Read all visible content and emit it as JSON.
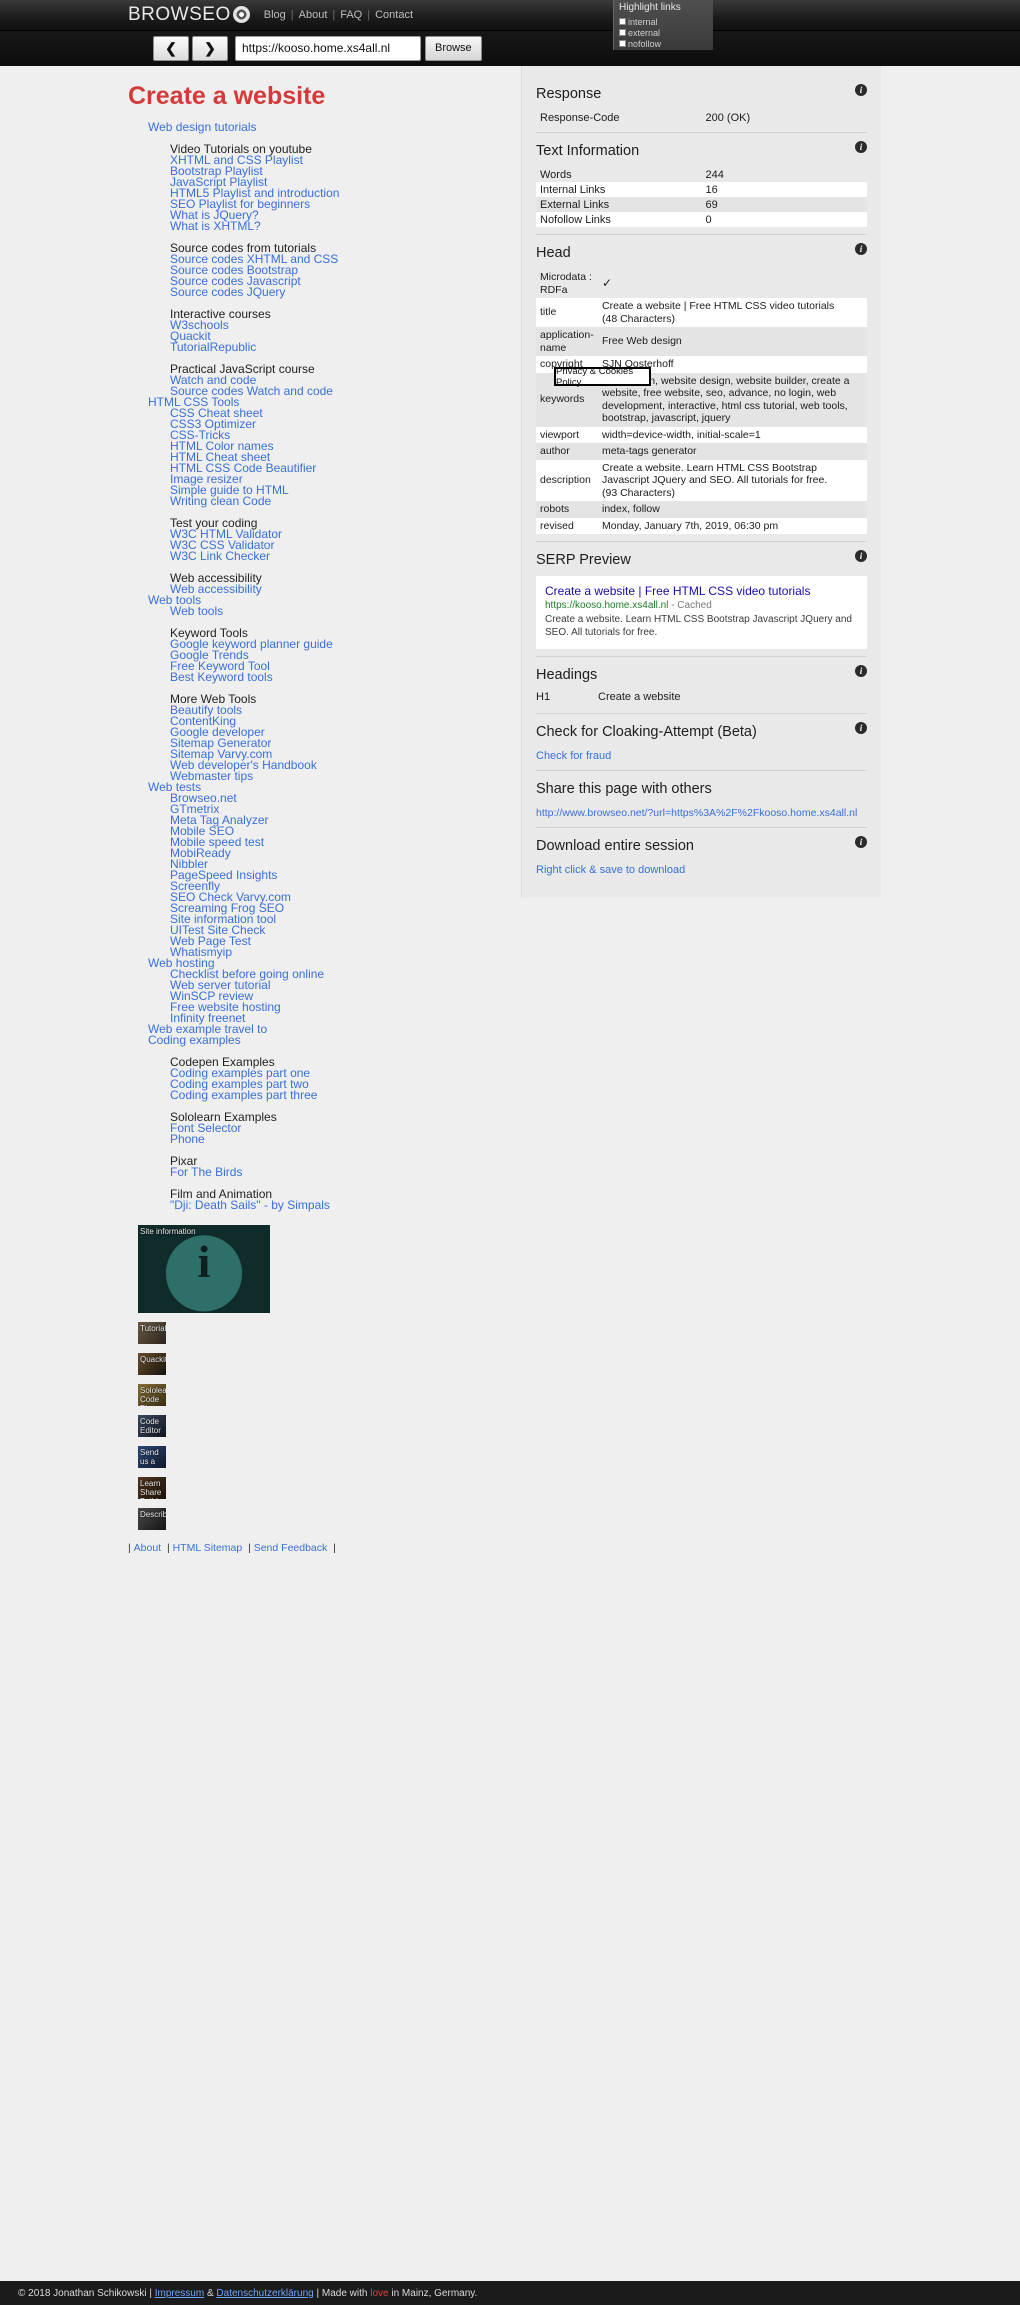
{
  "browser": {
    "brand": "BROWSEO",
    "nav": [
      "Blog",
      "About",
      "FAQ",
      "Contact"
    ],
    "back_icon": "❮",
    "forward_icon": "❯",
    "url_value": "https://kooso.home.xs4all.nl",
    "browse_label": "Browse",
    "highlight": {
      "title": "Highlight links",
      "options": [
        "internal",
        "external",
        "nofollow"
      ]
    }
  },
  "page": {
    "title": "Create a website",
    "tree": [
      {
        "level": 1,
        "label": "",
        "link": false
      },
      {
        "level": 1,
        "label": "Web design tutorials",
        "link": true
      },
      {
        "level": 2,
        "label": "",
        "link": false
      },
      {
        "level": 2,
        "label": "Video Tutorials on youtube",
        "link": false
      },
      {
        "level": 2,
        "label": "XHTML and CSS Playlist",
        "link": true
      },
      {
        "level": 2,
        "label": "Bootstrap Playlist",
        "link": true
      },
      {
        "level": 2,
        "label": "JavaScript Playlist",
        "link": true
      },
      {
        "level": 2,
        "label": "HTML5 Playlist and introduction",
        "link": true
      },
      {
        "level": 2,
        "label": "SEO Playlist for beginners",
        "link": true
      },
      {
        "level": 2,
        "label": "What is JQuery?",
        "link": true
      },
      {
        "level": 2,
        "label": "What is XHTML?",
        "link": true
      },
      {
        "level": 2,
        "label": "",
        "link": false
      },
      {
        "level": 2,
        "label": "Source codes from tutorials",
        "link": false
      },
      {
        "level": 2,
        "label": "Source codes XHTML and CSS",
        "link": true
      },
      {
        "level": 2,
        "label": "Source codes Bootstrap",
        "link": true
      },
      {
        "level": 2,
        "label": "Source codes Javascript",
        "link": true
      },
      {
        "level": 2,
        "label": "Source codes JQuery",
        "link": true
      },
      {
        "level": 2,
        "label": "",
        "link": false
      },
      {
        "level": 2,
        "label": "Interactive courses",
        "link": false
      },
      {
        "level": 2,
        "label": "W3schools",
        "link": true
      },
      {
        "level": 2,
        "label": "Quackit",
        "link": true
      },
      {
        "level": 2,
        "label": "TutorialRepublic",
        "link": true
      },
      {
        "level": 2,
        "label": "",
        "link": false
      },
      {
        "level": 2,
        "label": "Practical JavaScript course",
        "link": false
      },
      {
        "level": 2,
        "label": "Watch and code",
        "link": true
      },
      {
        "level": 2,
        "label": "Source codes Watch and code",
        "link": true
      },
      {
        "level": 1,
        "label": "HTML CSS Tools",
        "link": true
      },
      {
        "level": 2,
        "label": "CSS Cheat sheet",
        "link": true
      },
      {
        "level": 2,
        "label": "CSS3 Optimizer",
        "link": true
      },
      {
        "level": 2,
        "label": "CSS-Tricks",
        "link": true
      },
      {
        "level": 2,
        "label": "HTML Color names",
        "link": true
      },
      {
        "level": 2,
        "label": "HTML Cheat sheet",
        "link": true
      },
      {
        "level": 2,
        "label": "HTML CSS Code Beautifier",
        "link": true
      },
      {
        "level": 2,
        "label": "Image resizer",
        "link": true
      },
      {
        "level": 2,
        "label": "Simple guide to HTML",
        "link": true
      },
      {
        "level": 2,
        "label": "Writing clean Code",
        "link": true
      },
      {
        "level": 2,
        "label": "",
        "link": false
      },
      {
        "level": 2,
        "label": "Test your coding",
        "link": false
      },
      {
        "level": 2,
        "label": "W3C HTML Validator",
        "link": true
      },
      {
        "level": 2,
        "label": "W3C CSS Validator",
        "link": true
      },
      {
        "level": 2,
        "label": "W3C Link Checker",
        "link": true
      },
      {
        "level": 2,
        "label": "",
        "link": false
      },
      {
        "level": 2,
        "label": "Web accessibility",
        "link": false
      },
      {
        "level": 2,
        "label": "Web accessibility",
        "link": true
      },
      {
        "level": 1,
        "label": "Web tools",
        "link": true
      },
      {
        "level": 2,
        "label": "Web tools",
        "link": true
      },
      {
        "level": 2,
        "label": "",
        "link": false
      },
      {
        "level": 2,
        "label": "Keyword Tools",
        "link": false
      },
      {
        "level": 2,
        "label": "Google keyword planner guide",
        "link": true
      },
      {
        "level": 2,
        "label": "Google Trends",
        "link": true
      },
      {
        "level": 2,
        "label": "Free Keyword Tool",
        "link": true
      },
      {
        "level": 2,
        "label": "Best Keyword tools",
        "link": true
      },
      {
        "level": 2,
        "label": "",
        "link": false
      },
      {
        "level": 2,
        "label": "More Web Tools",
        "link": false
      },
      {
        "level": 2,
        "label": "Beautify tools",
        "link": true
      },
      {
        "level": 2,
        "label": "ContentKing",
        "link": true
      },
      {
        "level": 2,
        "label": "Google developer",
        "link": true
      },
      {
        "level": 2,
        "label": "Sitemap Generator",
        "link": true
      },
      {
        "level": 2,
        "label": "Sitemap Varvy.com",
        "link": true
      },
      {
        "level": 2,
        "label": "Web developer's Handbook",
        "link": true
      },
      {
        "level": 2,
        "label": "Webmaster tips",
        "link": true
      },
      {
        "level": 1,
        "label": "Web tests",
        "link": true
      },
      {
        "level": 2,
        "label": "Browseo.net",
        "link": true
      },
      {
        "level": 2,
        "label": "GTmetrix",
        "link": true
      },
      {
        "level": 2,
        "label": "Meta Tag Analyzer",
        "link": true
      },
      {
        "level": 2,
        "label": "Mobile SEO",
        "link": true
      },
      {
        "level": 2,
        "label": "Mobile speed test",
        "link": true
      },
      {
        "level": 2,
        "label": "MobiReady",
        "link": true
      },
      {
        "level": 2,
        "label": "Nibbler",
        "link": true
      },
      {
        "level": 2,
        "label": "PageSpeed Insights",
        "link": true
      },
      {
        "level": 2,
        "label": "Screenfly",
        "link": true
      },
      {
        "level": 2,
        "label": "SEO Check Varvy.com",
        "link": true
      },
      {
        "level": 2,
        "label": "Screaming Frog SEO",
        "link": true
      },
      {
        "level": 2,
        "label": "Site information tool",
        "link": true
      },
      {
        "level": 2,
        "label": "UITest Site Check",
        "link": true
      },
      {
        "level": 2,
        "label": "Web Page Test",
        "link": true
      },
      {
        "level": 2,
        "label": "Whatismyip",
        "link": true
      },
      {
        "level": 1,
        "label": "Web hosting",
        "link": true
      },
      {
        "level": 2,
        "label": "Checklist before going online",
        "link": true
      },
      {
        "level": 2,
        "label": "Web server tutorial",
        "link": true
      },
      {
        "level": 2,
        "label": "WinSCP review",
        "link": true
      },
      {
        "level": 2,
        "label": "Free website hosting",
        "link": true
      },
      {
        "level": 2,
        "label": "Infinity freenet",
        "link": true
      },
      {
        "level": 1,
        "label": "Web example travel to",
        "link": true
      },
      {
        "level": 1,
        "label": "Coding examples",
        "link": true
      },
      {
        "level": 2,
        "label": "",
        "link": false
      },
      {
        "level": 2,
        "label": "Codepen Examples",
        "link": false
      },
      {
        "level": 2,
        "label": "Coding examples part one",
        "link": true
      },
      {
        "level": 2,
        "label": "Coding examples part two",
        "link": true
      },
      {
        "level": 2,
        "label": "Coding examples part three",
        "link": true
      },
      {
        "level": 2,
        "label": "",
        "link": false
      },
      {
        "level": 2,
        "label": "Sololearn Examples",
        "link": false
      },
      {
        "level": 2,
        "label": "Font Selector",
        "link": true
      },
      {
        "level": 2,
        "label": "Phone",
        "link": true
      },
      {
        "level": 2,
        "label": "",
        "link": false
      },
      {
        "level": 2,
        "label": "Pixar",
        "link": false
      },
      {
        "level": 2,
        "label": "For The Birds",
        "link": true
      },
      {
        "level": 2,
        "label": "",
        "link": false
      },
      {
        "level": 2,
        "label": "Film and Animation",
        "link": false
      },
      {
        "level": 2,
        "label": "\"Dji: Death Sails\" - by Simpals",
        "link": true
      }
    ],
    "thumbnails": [
      {
        "name": "site-information",
        "caption": "Site information",
        "glyph": "i",
        "size": "big"
      },
      {
        "name": "tutorials",
        "caption": "Tutorials",
        "size": "small",
        "tone": "a"
      },
      {
        "name": "quackit",
        "caption": "Quackit",
        "size": "small",
        "tone": "b"
      },
      {
        "name": "sololearn-code-playground",
        "caption": "Sololearn Code Playground",
        "size": "small",
        "tone": "c"
      },
      {
        "name": "code-editor",
        "caption": "Code Editor",
        "size": "small",
        "tone": "d"
      },
      {
        "name": "send-us-a",
        "caption": "Send us a",
        "size": "small",
        "tone": "e"
      },
      {
        "name": "learn-share-build",
        "caption": "Learn Share Build",
        "size": "small",
        "tone": "f"
      },
      {
        "name": "describe",
        "caption": "Describe",
        "size": "small",
        "tone": "g"
      }
    ],
    "footer_links": [
      "About",
      "HTML Sitemap",
      "Send Feedback"
    ],
    "footer_bar": {
      "copyright": "© 2018 Jonathan Schikowski",
      "sep": "|",
      "impressum": "Impressum",
      "amp": "&",
      "datenschutz": "Datenschutzerklärung",
      "made_prefix": "| Made with",
      "heart": "love",
      "made_suffix": "in Mainz, Germany."
    }
  },
  "seo": {
    "response": {
      "heading": "Response",
      "rows": [
        [
          "Response-Code",
          "200 (OK)"
        ]
      ]
    },
    "text_information": {
      "heading": "Text Information",
      "rows": [
        [
          "Words",
          "244"
        ],
        [
          "Internal Links",
          "16"
        ],
        [
          "External Links",
          "69"
        ],
        [
          "Nofollow Links",
          "0"
        ]
      ]
    },
    "head": {
      "heading": "Head",
      "microdata_label": "Microdata : RDFa",
      "microdata_value": "✓",
      "rows": [
        [
          "title",
          "Create a website | Free HTML CSS video tutorials\n(48 Characters)"
        ],
        [
          "application-name",
          "Free Web design"
        ],
        [
          "copyright",
          "SJN Oosterhoff"
        ],
        [
          "keywords",
          "web design, website design, website builder, create a website, free website, seo, advance, no login, web development, interactive, html css tutorial, web tools, bootstrap, javascript, jquery"
        ],
        [
          "viewport",
          "width=device-width, initial-scale=1"
        ],
        [
          "author",
          "meta-tags generator"
        ],
        [
          "description",
          "Create a website. Learn HTML CSS Bootstrap Javascript JQuery and SEO. All tutorials for free.\n(93 Characters)"
        ],
        [
          "robots",
          "index, follow"
        ],
        [
          "revised",
          "Monday, January 7th, 2019, 06:30 pm"
        ]
      ]
    },
    "serp": {
      "heading": "SERP Preview",
      "title": "Create a website | Free HTML CSS video tutorials",
      "url": "https://kooso.home.xs4all.nl",
      "cached": "- Cached",
      "description": "Create a website. Learn HTML CSS Bootstrap Javascript JQuery and SEO. All tutorials for free."
    },
    "headings": {
      "heading": "Headings",
      "rows": [
        [
          "H1",
          "Create a website"
        ]
      ]
    },
    "cloaking": {
      "heading": "Check for Cloaking-Attempt (Beta)",
      "link": "Check for fraud"
    },
    "share": {
      "heading": "Share this page with others",
      "url": "http://www.browseo.net/?url=https%3A%2F%2Fkooso.home.xs4all.nl"
    },
    "download": {
      "heading": "Download entire session",
      "link": "Right click & save to download"
    },
    "info_icon": "i"
  },
  "overlay": {
    "privacy_label": "Privacy & Cookies Policy"
  },
  "colors": {
    "accent_red": "#d43a3a",
    "link_blue": "#3a6fd8",
    "serp_blue": "#1a0dab",
    "serp_green": "#1f7a26",
    "panel_bg": "#e9e9e9"
  }
}
